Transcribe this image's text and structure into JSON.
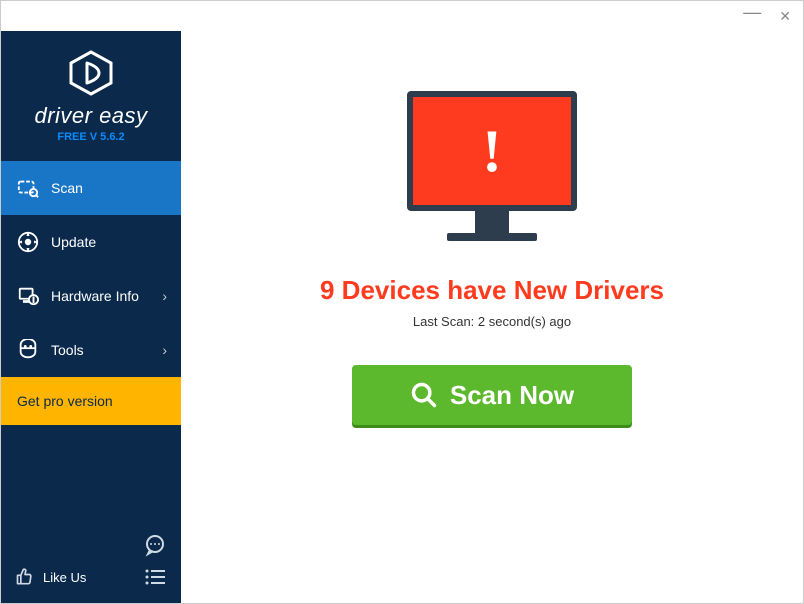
{
  "app": {
    "name": "driver easy",
    "version_label": "FREE V 5.6.2"
  },
  "sidebar": {
    "items": [
      {
        "label": "Scan",
        "has_chevron": false
      },
      {
        "label": "Update",
        "has_chevron": false
      },
      {
        "label": "Hardware Info",
        "has_chevron": true
      },
      {
        "label": "Tools",
        "has_chevron": true
      }
    ],
    "get_pro_label": "Get pro version",
    "like_us_label": "Like Us"
  },
  "main": {
    "headline": "9 Devices have New Drivers",
    "last_scan_label": "Last Scan: 2 second(s) ago",
    "scan_button_label": "Scan Now"
  }
}
